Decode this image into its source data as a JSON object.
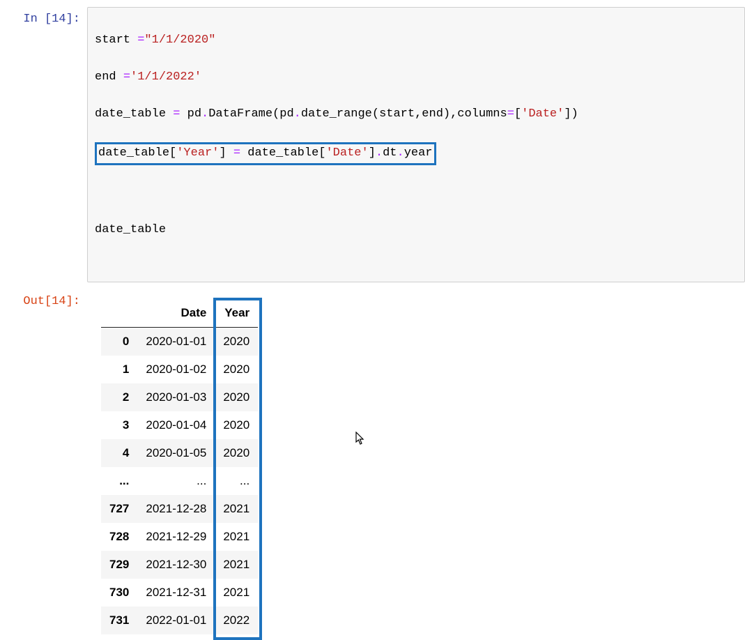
{
  "in_prompt": "In [14]:",
  "out_prompt": "Out[14]:",
  "code": {
    "l1_a": "start ",
    "l1_op": "=",
    "l1_str": "\"1/1/2020\"",
    "l2_a": "end ",
    "l2_op": "=",
    "l2_str": "'1/1/2022'",
    "l3_a": "date_table ",
    "l3_op": "=",
    "l3_b": " pd",
    "l3_dot1": ".",
    "l3_c": "DataFrame(pd",
    "l3_dot2": ".",
    "l3_d": "date_range(start,end),columns",
    "l3_op2": "=",
    "l3_e": "[",
    "l3_str1": "'Date'",
    "l3_f": "])",
    "l4_a": "date_table[",
    "l4_str1": "'Year'",
    "l4_b": "] ",
    "l4_op": "=",
    "l4_c": " date_table[",
    "l4_str2": "'Date'",
    "l4_d": "]",
    "l4_dot1": ".",
    "l4_e": "dt",
    "l4_dot2": ".",
    "l4_f": "year",
    "l6": "date_table"
  },
  "table": {
    "columns": [
      "Date",
      "Year"
    ],
    "rows": [
      {
        "idx": "0",
        "date": "2020-01-01",
        "year": "2020"
      },
      {
        "idx": "1",
        "date": "2020-01-02",
        "year": "2020"
      },
      {
        "idx": "2",
        "date": "2020-01-03",
        "year": "2020"
      },
      {
        "idx": "3",
        "date": "2020-01-04",
        "year": "2020"
      },
      {
        "idx": "4",
        "date": "2020-01-05",
        "year": "2020"
      },
      {
        "idx": "...",
        "date": "...",
        "year": "..."
      },
      {
        "idx": "727",
        "date": "2021-12-28",
        "year": "2021"
      },
      {
        "idx": "728",
        "date": "2021-12-29",
        "year": "2021"
      },
      {
        "idx": "729",
        "date": "2021-12-30",
        "year": "2021"
      },
      {
        "idx": "730",
        "date": "2021-12-31",
        "year": "2021"
      },
      {
        "idx": "731",
        "date": "2022-01-01",
        "year": "2022"
      }
    ]
  },
  "highlight_color": "#1E73BE"
}
